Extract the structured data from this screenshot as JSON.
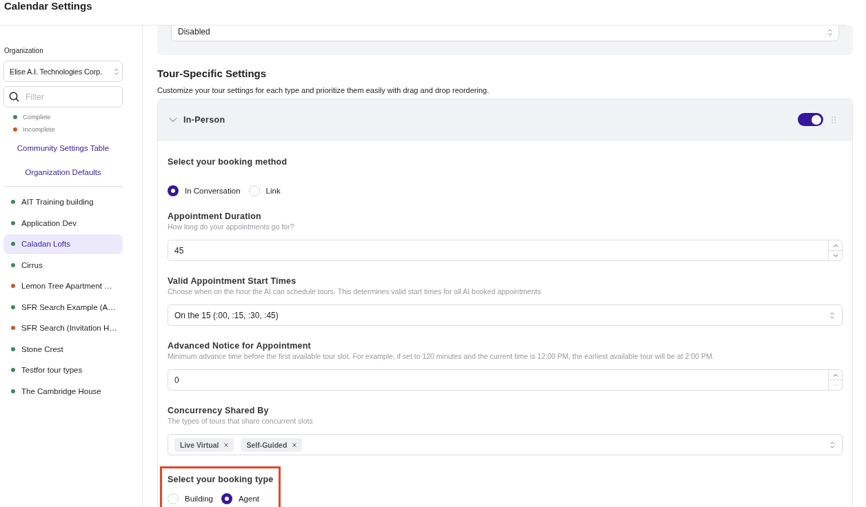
{
  "page_title": "Calendar Settings",
  "sidebar": {
    "org_label": "Organization",
    "org_select": "Elise A.I. Technologies Corp.",
    "filter": {
      "placeholder": "Filter"
    },
    "legend": [
      {
        "label": "Complete",
        "color": "#3f8a4f"
      },
      {
        "label": "Incomplete",
        "color": "#c8582c"
      }
    ],
    "links": [
      "Community Settings Table",
      "Organization Defaults"
    ],
    "items": [
      {
        "label": "AIT Training building",
        "color": "#3f8a4f",
        "selected": false
      },
      {
        "label": "Application Dev",
        "color": "#3f8a4f",
        "selected": false
      },
      {
        "label": "Caladan Lofts",
        "color": "#3f8a4f",
        "selected": true
      },
      {
        "label": "Cirrus",
        "color": "#3f8a4f",
        "selected": false
      },
      {
        "label": "Lemon Tree Apartment …",
        "color": "#c8582c",
        "selected": false
      },
      {
        "label": "SFR Search Example (A…",
        "color": "#3f8a4f",
        "selected": false
      },
      {
        "label": "SFR Search (Invitation H…",
        "color": "#c8582c",
        "selected": false
      },
      {
        "label": "Stone Crest",
        "color": "#3f8a4f",
        "selected": false
      },
      {
        "label": "Testfor tour types",
        "color": "#3f8a4f",
        "selected": false
      },
      {
        "label": "The Cambridge House",
        "color": "#3f8a4f",
        "selected": false
      }
    ]
  },
  "top_select": "Disabled",
  "section": {
    "title": "Tour-Specific Settings",
    "description": "Customize your tour settings for each type and prioritize them easily with drag and drop reordering."
  },
  "tour": {
    "name": "In-Person",
    "expanded": true,
    "on": true,
    "fields": [
      {
        "kind": "radio",
        "label": "Select your booking method",
        "highlighted": false,
        "options": [
          {
            "label": "In Conversation",
            "selected": true
          },
          {
            "label": "Link",
            "selected": false
          }
        ]
      },
      {
        "kind": "number",
        "label": "Appointment Duration",
        "hint": "How long do your appointments go for?",
        "value": "45",
        "decrement_disabled": false
      },
      {
        "kind": "select",
        "label": "Valid Appointment Start Times",
        "hint": "Choose when on the hour the AI can schedule tours. This determines valid start times for all AI booked appointments",
        "value": "On the 15 (:00, :15, :30, :45)"
      },
      {
        "kind": "number",
        "label": "Advanced Notice for Appointment",
        "hint": "Minimum advance time before the first available tour slot. For example, if set to 120 minutes and the current time is 12:00 PM, the earliest available tour will be at 2:00 PM.",
        "value": "0",
        "decrement_disabled": true
      },
      {
        "kind": "tags",
        "label": "Concurrency Shared By",
        "hint": "The types of tours that share concurrent slots",
        "tags": [
          "Live Virtual",
          "Self-Guided"
        ]
      },
      {
        "kind": "radio",
        "label": "Select your booking type",
        "highlighted": true,
        "options": [
          {
            "label": "Building",
            "selected": false
          },
          {
            "label": "Agent",
            "selected": true
          }
        ]
      }
    ]
  }
}
